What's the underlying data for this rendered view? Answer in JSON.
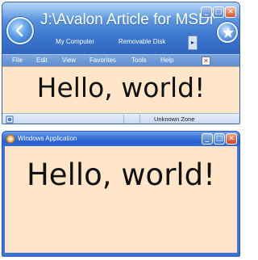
{
  "browser": {
    "address_title": "J:\\Avalon Article for MSDN...",
    "breadcrumbs": [
      "My Computer",
      "Removable Disk"
    ],
    "breadcrumb_more": "▸",
    "window_buttons": {
      "minimize": "_",
      "maximize": "□",
      "close": "✕"
    },
    "menu": [
      "File",
      "Edit",
      "View",
      "Favorites",
      "Tools",
      "Help"
    ],
    "menu_close": "✕",
    "content_text": "Hello, world!",
    "status_zone": "Unknown Zone",
    "icons": [
      "back-arrow-icon",
      "favorites-star-icon",
      "page-status-icon"
    ]
  },
  "app": {
    "title": "Windows Application",
    "window_buttons": {
      "minimize": "_",
      "maximize": "□",
      "close": "✕"
    },
    "content_text": "Hello, world!",
    "icons": [
      "application-icon"
    ]
  },
  "colors": {
    "content_background": "#ffe6c8",
    "titlebar_blue": "#3f78dc",
    "close_red": "#d4441c"
  }
}
